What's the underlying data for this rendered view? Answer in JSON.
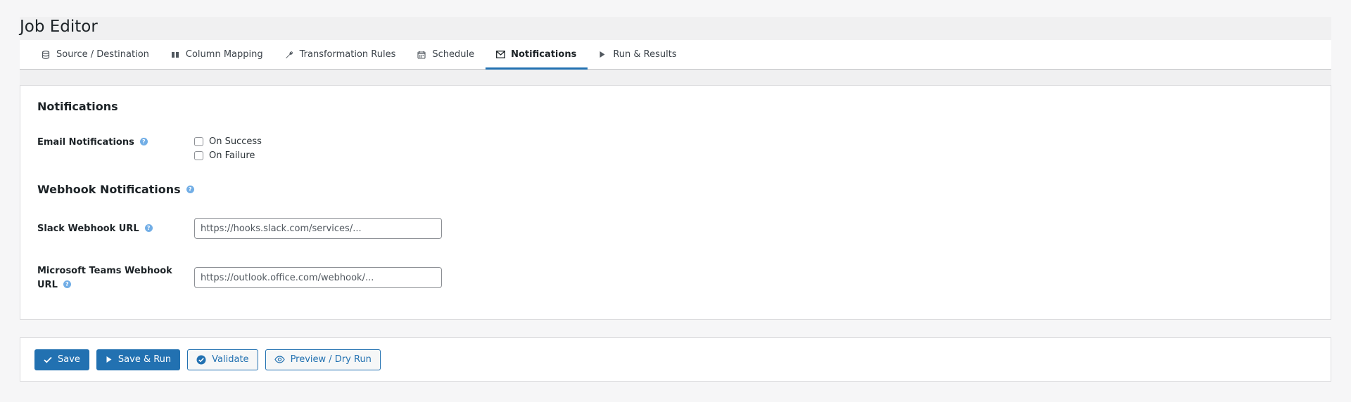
{
  "page": {
    "title": "Job Editor"
  },
  "tabs": [
    {
      "label": "Source / Destination",
      "icon": "database-icon"
    },
    {
      "label": "Column Mapping",
      "icon": "columns-icon"
    },
    {
      "label": "Transformation Rules",
      "icon": "wrench-icon"
    },
    {
      "label": "Schedule",
      "icon": "calendar-icon"
    },
    {
      "label": "Notifications",
      "icon": "envelope-icon",
      "active": true
    },
    {
      "label": "Run & Results",
      "icon": "play-icon"
    }
  ],
  "notifications": {
    "title": "Notifications",
    "email_label": "Email Notifications",
    "on_success_label": "On Success",
    "on_failure_label": "On Failure",
    "webhook_title": "Webhook Notifications",
    "slack_label": "Slack Webhook URL",
    "slack_placeholder": "https://hooks.slack.com/services/...",
    "teams_label_line1": "Microsoft Teams Webhook",
    "teams_label_line2": "URL",
    "teams_placeholder": "https://outlook.office.com/webhook/..."
  },
  "actions": {
    "save_label": "Save",
    "save_run_label": "Save & Run",
    "validate_label": "Validate",
    "preview_label": "Preview / Dry Run"
  },
  "colors": {
    "accent": "#2271b1",
    "help_icon": "#72aee6"
  }
}
